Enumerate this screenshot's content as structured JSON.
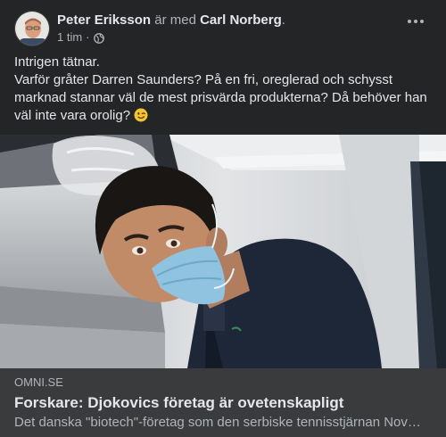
{
  "post": {
    "author": "Peter Eriksson",
    "with_text": "är med",
    "tagged": "Carl Norberg",
    "punct": ".",
    "time": "1 tim",
    "time_sep": "·",
    "privacy_icon": "globe-icon",
    "more_icon": "more-horizontal-icon",
    "text_lines": [
      "Intrigen tätnar.",
      "Varför gråter Darren Saunders? På en fri, oreglerad och schysst marknad stannar väl de mest prisvärda produkterna? Då behöver han väl inte vara orolig?"
    ],
    "emoji": "winking-face-icon"
  },
  "link": {
    "domain": "OMNI.SE",
    "title": "Forskare: Djokovics företag är ovetenskapligt",
    "description": "Det danska \"biotech\"-företag som den serbiske tennisstjärnan Nov…"
  },
  "colors": {
    "background": "#242526",
    "link_box": "#3a3b3c",
    "primary_text": "#e4e6eb",
    "secondary_text": "#b0b3b8"
  }
}
